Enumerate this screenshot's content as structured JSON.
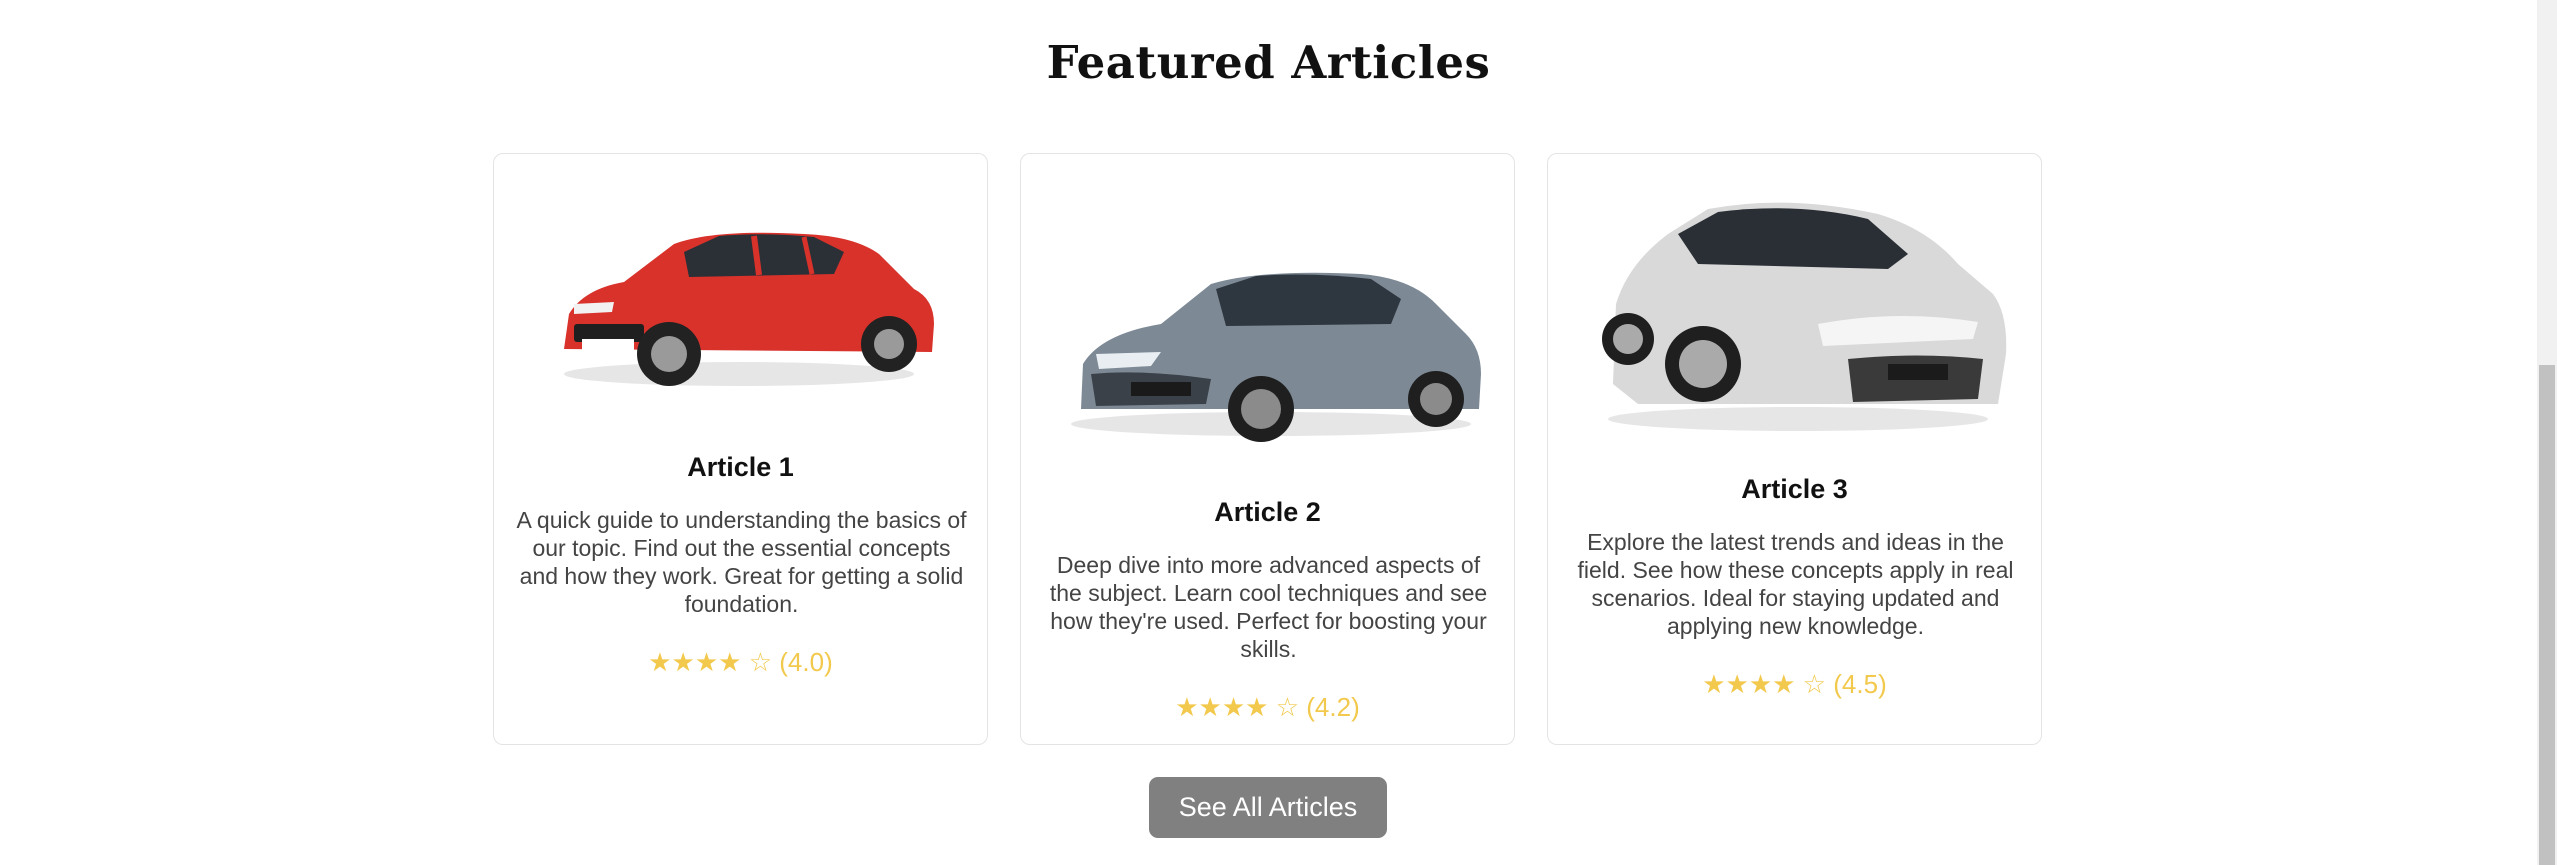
{
  "section": {
    "title": "Featured Articles"
  },
  "articles": [
    {
      "title": "Article 1",
      "description": "A quick guide to understanding the basics of our topic. Find out the essential concepts and how they work. Great for getting a solid foundation.",
      "rating_stars": "★★★★ ☆",
      "rating_value": "(4.0)",
      "car_color": "#d8322b",
      "car_alt": "red hatchback car"
    },
    {
      "title": "Article 2",
      "description": "Deep dive into more advanced aspects of the subject. Learn cool techniques and see how they're used. Perfect for boosting your skills.",
      "rating_stars": "★★★★ ☆",
      "rating_value": "(4.2)",
      "car_color": "#7d8a96",
      "car_alt": "grey sedan car"
    },
    {
      "title": "Article 3",
      "description": "Explore the latest trends and ideas in the field. See how these concepts apply in real scenarios. Ideal for staying updated and applying new knowledge.",
      "rating_stars": "★★★★ ☆",
      "rating_value": "(4.5)",
      "car_color": "#d9d9d9",
      "car_alt": "white sedan car"
    }
  ],
  "actions": {
    "see_all_label": "See All Articles"
  },
  "colors": {
    "star": "#f2c94c",
    "button_bg": "#808080",
    "card_border": "#e4e4e4"
  }
}
